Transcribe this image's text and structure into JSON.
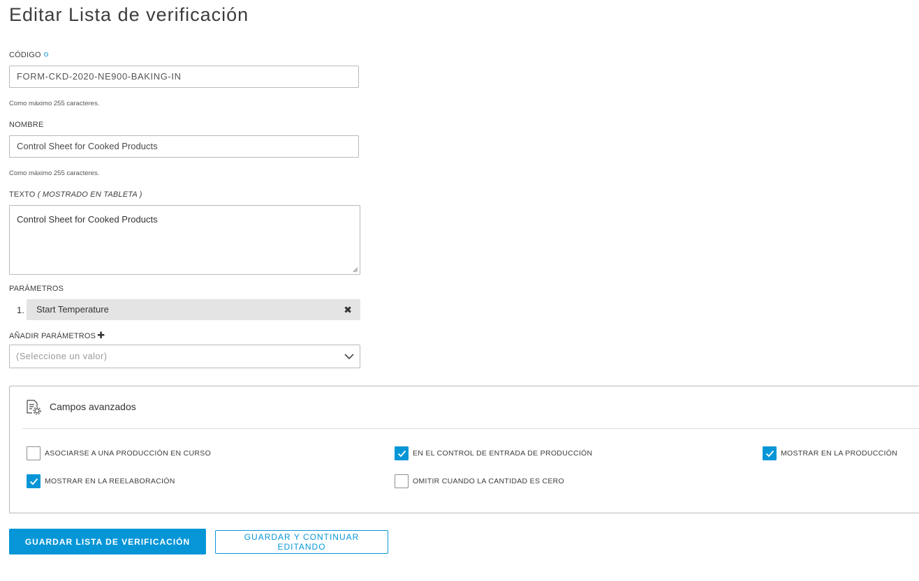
{
  "page": {
    "title": "Editar Lista de verificación"
  },
  "form": {
    "code": {
      "label": "CÓDIGO",
      "value": "FORM-CKD-2020-NE900-BAKING-IN",
      "hint": "Como máximo 255 caracteres."
    },
    "name": {
      "label": "NOMBRE",
      "value": "Control Sheet for Cooked Products",
      "hint": "Como máximo 255 caracteres."
    },
    "text": {
      "label": "TEXTO",
      "label_suffix": "( MOSTRADO EN TABLETA )",
      "value": "Control Sheet for Cooked Products"
    },
    "parameters": {
      "label": "PARÁMETROS",
      "items": [
        {
          "number": "1.",
          "name": "Start Temperature"
        }
      ]
    },
    "add_parameters": {
      "label": "AÑADIR PARÁMETROS",
      "placeholder": "(Seleccione un valor)"
    }
  },
  "advanced": {
    "title": "Campos avanzados",
    "options": [
      {
        "label": "ASOCIARSE A UNA PRODUCCIÓN EN CURSO",
        "checked": false
      },
      {
        "label": "EN EL CONTROL DE ENTRADA DE PRODUCCIÓN",
        "checked": true
      },
      {
        "label": "MOSTRAR EN LA PRODUCCIÓN",
        "checked": true
      },
      {
        "label": "MOSTRAR EN LA REELABORACIÓN",
        "checked": true
      },
      {
        "label": "OMITIR CUANDO LA CANTIDAD ES CERO",
        "checked": false
      }
    ]
  },
  "actions": {
    "save_label": "GUARDAR LISTA DE VERIFICACIÓN",
    "save_continue_label": "GUARDAR Y CONTINUAR EDITANDO"
  },
  "colors": {
    "accent": "#0696d7",
    "param_bg": "#e4e4e4"
  }
}
